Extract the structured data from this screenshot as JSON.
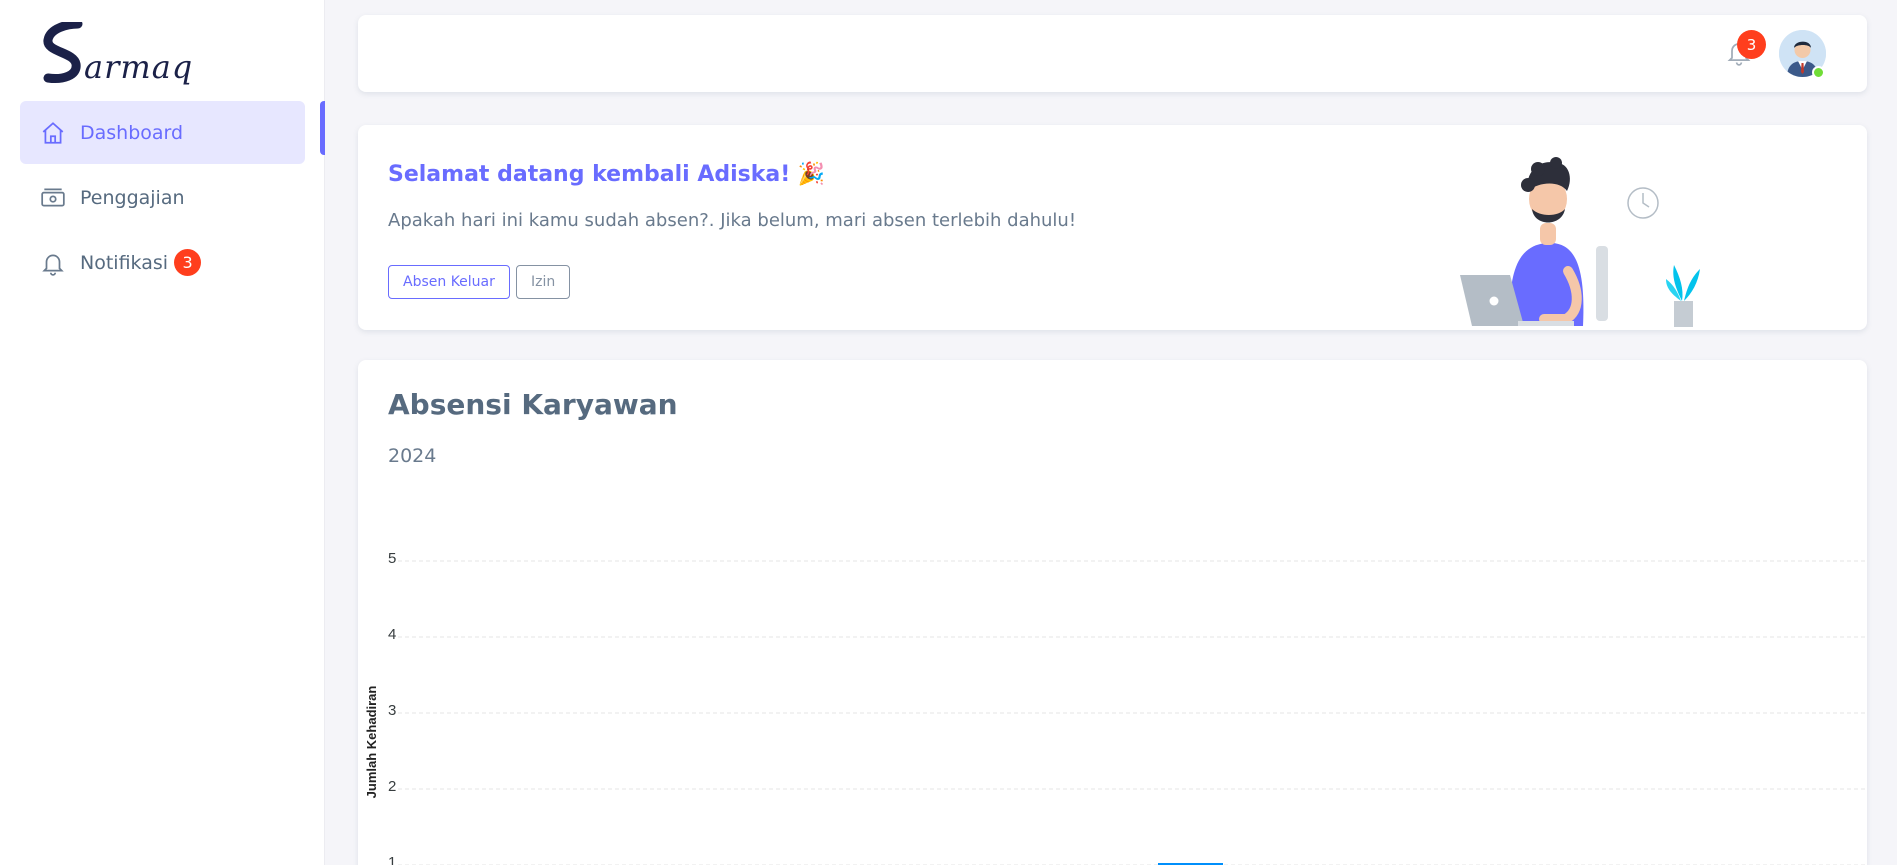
{
  "brand": {
    "logo_initial": "S",
    "logo_text": "armaq"
  },
  "sidebar": {
    "items": [
      {
        "label": "Dashboard",
        "icon": "home-icon",
        "active": true
      },
      {
        "label": "Penggajian",
        "icon": "money-icon",
        "active": false
      },
      {
        "label": "Notifikasi",
        "icon": "bell-icon",
        "active": false,
        "badge": "3"
      }
    ]
  },
  "navbar": {
    "notification_count": "3",
    "avatar": "user-avatar",
    "status_color": "#71dd37"
  },
  "welcome": {
    "title": "Selamat datang kembali Adiska! 🎉",
    "message": "Apakah hari ini kamu sudah absen?. Jika belum, mari absen terlebih dahulu!",
    "btn_checkout": "Absen Keluar",
    "btn_permit": "Izin"
  },
  "colors": {
    "accent": "#696cff",
    "badge": "#ff3e1d",
    "bar": "#008ffb"
  },
  "chart_data": {
    "type": "bar",
    "title": "Absensi Karyawan",
    "subtitle": "2024",
    "ylabel": "Jumlah Kehadiran",
    "yticks": [
      "5",
      "4",
      "3",
      "2",
      "1"
    ],
    "ylim": [
      0,
      5
    ],
    "grid": true,
    "values": [
      1
    ]
  }
}
